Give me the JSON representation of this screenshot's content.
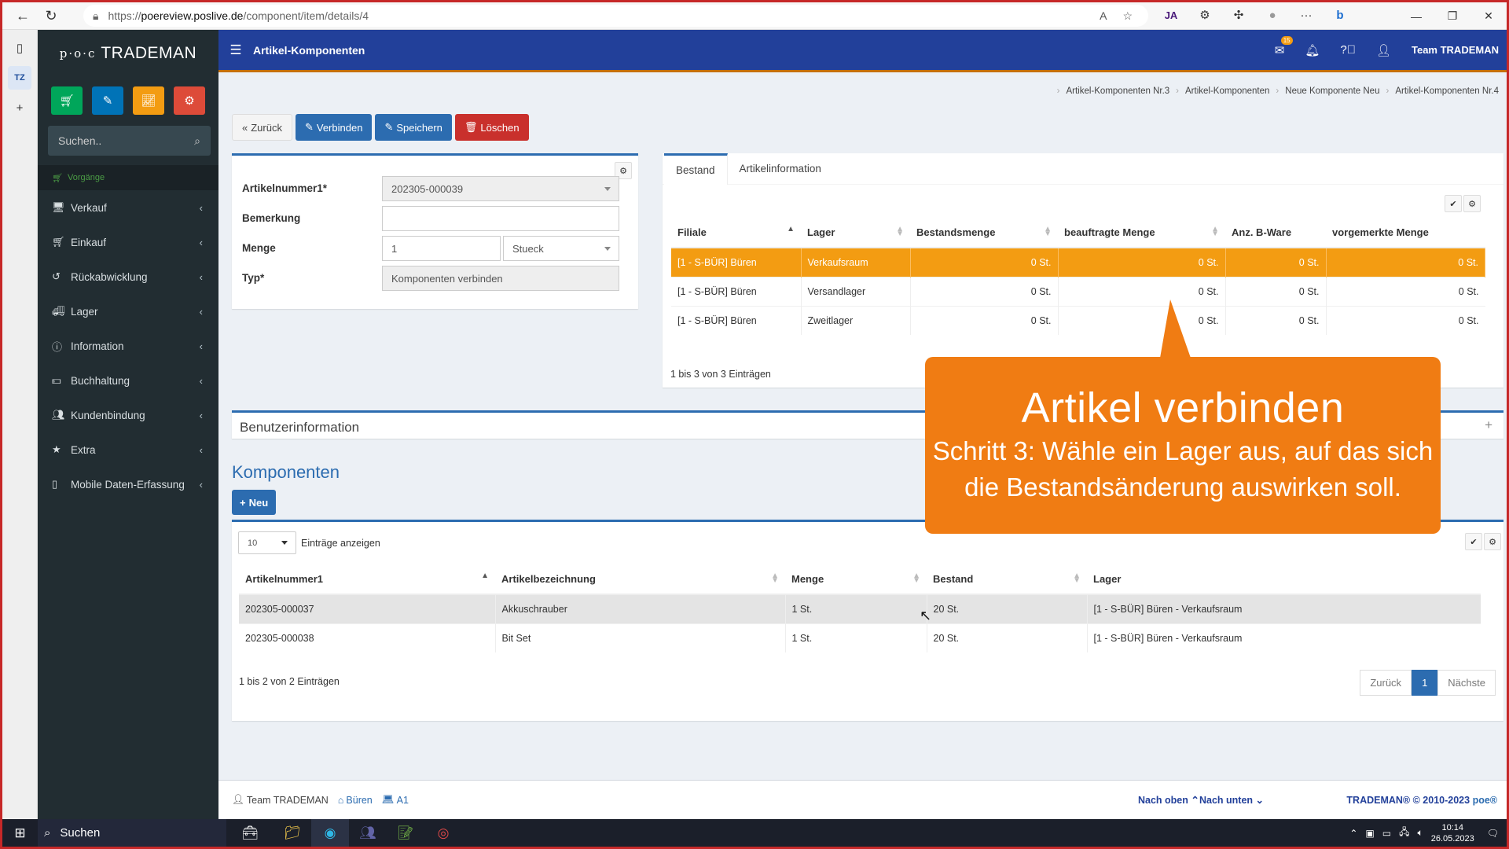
{
  "browser": {
    "url_prefix": "https://",
    "url_host": "poereview.poslive.de",
    "url_path": "/component/item/details/4"
  },
  "app": {
    "brand": "TRADEMAN",
    "brand_prefix": "p·o·c",
    "page_title": "Artikel-Komponenten",
    "user": "Team TRADEMAN",
    "mail_badge": "15",
    "search_placeholder": "Suchen.."
  },
  "quick_buttons": [
    {
      "name": "cart",
      "color": "#00a65a"
    },
    {
      "name": "pencil",
      "color": "#0073b7"
    },
    {
      "name": "chart",
      "color": "#f39c12"
    },
    {
      "name": "gears",
      "color": "#dd4b39"
    }
  ],
  "sidebar": {
    "header": "Vorgänge",
    "items": [
      {
        "label": "Verkauf",
        "icon": "monitor-icon"
      },
      {
        "label": "Einkauf",
        "icon": "cart-icon"
      },
      {
        "label": "Rückabwicklung",
        "icon": "undo-icon"
      },
      {
        "label": "Lager",
        "icon": "truck-icon"
      },
      {
        "label": "Information",
        "icon": "info-icon"
      },
      {
        "label": "Buchhaltung",
        "icon": "money-icon"
      },
      {
        "label": "Kundenbindung",
        "icon": "users-icon"
      },
      {
        "label": "Extra",
        "icon": "star-icon"
      },
      {
        "label": "Mobile Daten-Erfassung",
        "icon": "mobile-icon"
      }
    ]
  },
  "breadcrumb": [
    "Artikel-Komponenten Nr.3",
    "Artikel-Komponenten",
    "Neue Komponente Neu",
    "Artikel-Komponenten Nr.4"
  ],
  "actions": {
    "back": "Zurück",
    "connect": "Verbinden",
    "save": "Speichern",
    "delete": "Löschen"
  },
  "form": {
    "artikelnummer_label": "Artikelnummer1*",
    "artikelnummer_value": "202305-000039",
    "bemerkung_label": "Bemerkung",
    "bemerkung_value": "",
    "menge_label": "Menge",
    "menge_value": "1",
    "menge_unit": "Stueck",
    "typ_label": "Typ*",
    "typ_value": "Komponenten verbinden"
  },
  "stock": {
    "tabs": [
      "Bestand",
      "Artikelinformation"
    ],
    "columns": [
      "Filiale",
      "Lager",
      "Bestandsmenge",
      "beauftragte Menge",
      "Anz. B-Ware",
      "vorgemerkte Menge"
    ],
    "rows": [
      [
        "[1 - S-BÜR] Büren",
        "Verkaufsraum",
        "0 St.",
        "0 St.",
        "0 St.",
        "0 St."
      ],
      [
        "[1 - S-BÜR] Büren",
        "Versandlager",
        "0 St.",
        "0 St.",
        "0 St.",
        "0 St."
      ],
      [
        "[1 - S-BÜR] Büren",
        "Zweitlager",
        "0 St.",
        "0 St.",
        "0 St.",
        "0 St."
      ]
    ],
    "info": "1 bis 3 von 3 Einträgen"
  },
  "userinfo_title": "Benutzerinformation",
  "components": {
    "title": "Komponenten",
    "new_button": "Neu",
    "page_size": "10",
    "page_size_label": "Einträge anzeigen",
    "columns": [
      "Artikelnummer1",
      "Artikelbezeichnung",
      "Menge",
      "Bestand",
      "Lager"
    ],
    "rows": [
      [
        "202305-000037",
        "Akkuschrauber",
        "1 St.",
        "20 St.",
        "[1 - S-BÜR] Büren - Verkaufsraum"
      ],
      [
        "202305-000038",
        "Bit Set",
        "1 St.",
        "20 St.",
        "[1 - S-BÜR] Büren - Verkaufsraum"
      ]
    ],
    "info": "1 bis 2 von 2 Einträgen",
    "pager": {
      "prev": "Zurück",
      "page": "1",
      "next": "Nächste"
    }
  },
  "callout": {
    "title": "Artikel verbinden",
    "line1": "Schritt 3: Wähle ein Lager aus, auf das sich",
    "line2": "die Bestandsänderung auswirken soll."
  },
  "footer": {
    "user": "Team TRADEMAN",
    "branch": "Büren",
    "terminal": "A1",
    "up": "Nach oben",
    "down": "Nach unten",
    "copyright": "TRADEMAN® © 2010-2023",
    "poe": "poe®"
  },
  "taskbar": {
    "search": "Suchen",
    "time": "10:14",
    "date": "26.05.2023"
  }
}
